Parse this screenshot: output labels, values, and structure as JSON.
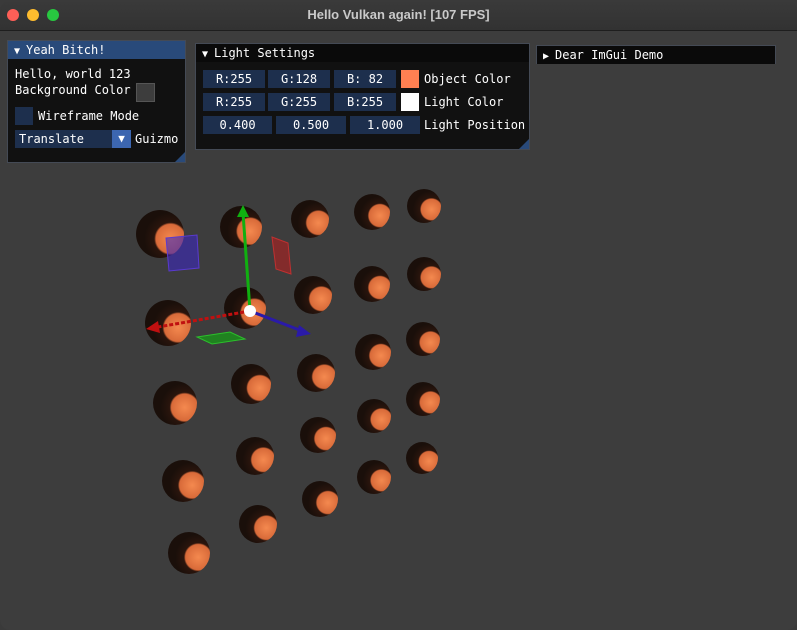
{
  "window": {
    "title": "Hello Vulkan again!  [107 FPS]"
  },
  "panel_main": {
    "title": "Yeah Bitch!",
    "hello_text": "Hello, world 123",
    "bg_color_label": "Background Color",
    "bg_color_value": "#3d3d3d",
    "wireframe_label": "Wireframe Mode",
    "wireframe_checked": false,
    "mode_selected": "Translate",
    "guizmo_label": "Guizmo"
  },
  "panel_light": {
    "title": "Light Settings",
    "object_color": {
      "r": "R:255",
      "g": "G:128",
      "b": "B: 82",
      "swatch": "#ff8052",
      "label": "Object Color"
    },
    "light_color": {
      "r": "R:255",
      "g": "G:255",
      "b": "B:255",
      "swatch": "#ffffff",
      "label": "Light Color"
    },
    "light_position": {
      "x": "0.400",
      "y": "0.500",
      "z": "1.000",
      "label": "Light Position"
    }
  },
  "panel_demo": {
    "title": "Dear ImGui Demo"
  },
  "colors": {
    "imgui_title_active": "#294a7a",
    "imgui_frame_bg": "#1d2f4d",
    "viewport_bg": "#3d3d3d",
    "sphere_lit": "#f07c48",
    "sphere_dark": "#1c100b",
    "gizmo_x": "#c01010",
    "gizmo_y": "#10b010",
    "gizmo_z": "#2a1aa8"
  },
  "icons": {
    "collapse_open": "▼",
    "collapse_closed": "▶",
    "combo_arrow": "▼"
  }
}
